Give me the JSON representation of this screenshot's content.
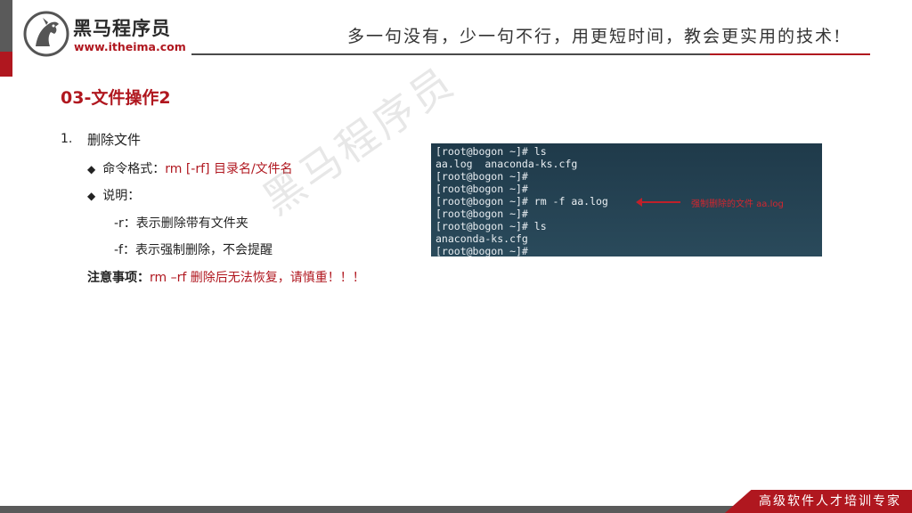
{
  "header": {
    "brand_name": "黑马程序员",
    "brand_url": "www.itheima.com",
    "slogan": "多一句没有，少一句不行，用更短时间，教会更实用的技术!"
  },
  "slide": {
    "title": "03-文件操作2",
    "item_number": "1.",
    "item_title": "删除文件",
    "bullet_symbol": "◆",
    "cmd_label": "命令格式：",
    "cmd_value": "rm [-rf]  目录名/文件名",
    "explain_label": "说明：",
    "opt_r": "-r：表示删除带有文件夹",
    "opt_f": "-f：表示强制删除，不会提醒",
    "note_label": "注意事项：",
    "note_value": "rm –rf  删除后无法恢复，请慎重！！！"
  },
  "terminal": {
    "lines": [
      "[root@bogon ~]# ls",
      "aa.log  anaconda-ks.cfg",
      "[root@bogon ~]#",
      "[root@bogon ~]#",
      "[root@bogon ~]# rm -f aa.log",
      "[root@bogon ~]#",
      "[root@bogon ~]# ls",
      "anaconda-ks.cfg",
      "[root@bogon ~]#"
    ],
    "annotation": "强制删除的文件 aa.log"
  },
  "watermark": "黑马程序员",
  "footer": {
    "slogan": "高级软件人才培训专家"
  },
  "colors": {
    "brand_red": "#b0171f",
    "header_gray": "#5a5a5a",
    "terminal_bg": "#24414f"
  }
}
